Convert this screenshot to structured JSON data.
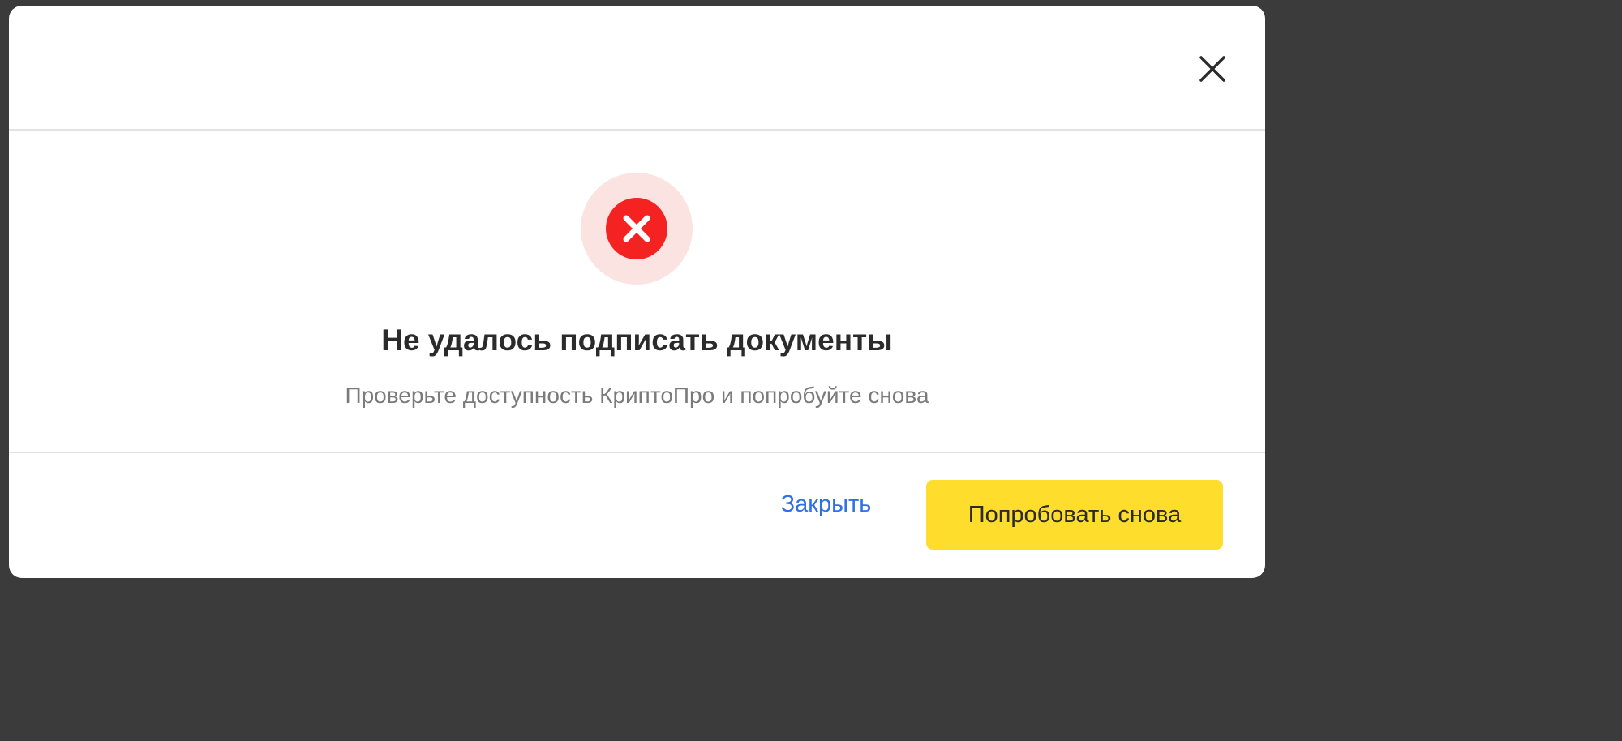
{
  "dialog": {
    "close_icon": "close-icon",
    "status_icon": "error-cross-icon",
    "title": "Не удалось подписать документы",
    "message": "Проверьте доступность КриптоПро и попробуйте снова",
    "buttons": {
      "close_label": "Закрыть",
      "retry_label": "Попробовать снова"
    }
  },
  "colors": {
    "error": "#f52222",
    "error_halo": "#fbe3e1",
    "primary_button": "#ffdd2d",
    "link": "#2f6fe8"
  }
}
